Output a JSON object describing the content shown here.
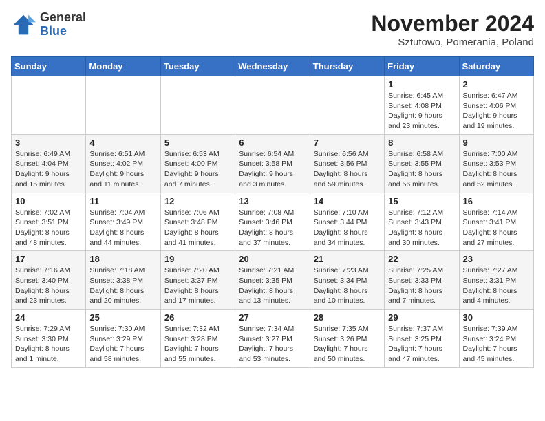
{
  "logo": {
    "general": "General",
    "blue": "Blue"
  },
  "title": "November 2024",
  "subtitle": "Sztutowo, Pomerania, Poland",
  "weekdays": [
    "Sunday",
    "Monday",
    "Tuesday",
    "Wednesday",
    "Thursday",
    "Friday",
    "Saturday"
  ],
  "weeks": [
    [
      {
        "day": "",
        "info": ""
      },
      {
        "day": "",
        "info": ""
      },
      {
        "day": "",
        "info": ""
      },
      {
        "day": "",
        "info": ""
      },
      {
        "day": "",
        "info": ""
      },
      {
        "day": "1",
        "info": "Sunrise: 6:45 AM\nSunset: 4:08 PM\nDaylight: 9 hours\nand 23 minutes."
      },
      {
        "day": "2",
        "info": "Sunrise: 6:47 AM\nSunset: 4:06 PM\nDaylight: 9 hours\nand 19 minutes."
      }
    ],
    [
      {
        "day": "3",
        "info": "Sunrise: 6:49 AM\nSunset: 4:04 PM\nDaylight: 9 hours\nand 15 minutes."
      },
      {
        "day": "4",
        "info": "Sunrise: 6:51 AM\nSunset: 4:02 PM\nDaylight: 9 hours\nand 11 minutes."
      },
      {
        "day": "5",
        "info": "Sunrise: 6:53 AM\nSunset: 4:00 PM\nDaylight: 9 hours\nand 7 minutes."
      },
      {
        "day": "6",
        "info": "Sunrise: 6:54 AM\nSunset: 3:58 PM\nDaylight: 9 hours\nand 3 minutes."
      },
      {
        "day": "7",
        "info": "Sunrise: 6:56 AM\nSunset: 3:56 PM\nDaylight: 8 hours\nand 59 minutes."
      },
      {
        "day": "8",
        "info": "Sunrise: 6:58 AM\nSunset: 3:55 PM\nDaylight: 8 hours\nand 56 minutes."
      },
      {
        "day": "9",
        "info": "Sunrise: 7:00 AM\nSunset: 3:53 PM\nDaylight: 8 hours\nand 52 minutes."
      }
    ],
    [
      {
        "day": "10",
        "info": "Sunrise: 7:02 AM\nSunset: 3:51 PM\nDaylight: 8 hours\nand 48 minutes."
      },
      {
        "day": "11",
        "info": "Sunrise: 7:04 AM\nSunset: 3:49 PM\nDaylight: 8 hours\nand 44 minutes."
      },
      {
        "day": "12",
        "info": "Sunrise: 7:06 AM\nSunset: 3:48 PM\nDaylight: 8 hours\nand 41 minutes."
      },
      {
        "day": "13",
        "info": "Sunrise: 7:08 AM\nSunset: 3:46 PM\nDaylight: 8 hours\nand 37 minutes."
      },
      {
        "day": "14",
        "info": "Sunrise: 7:10 AM\nSunset: 3:44 PM\nDaylight: 8 hours\nand 34 minutes."
      },
      {
        "day": "15",
        "info": "Sunrise: 7:12 AM\nSunset: 3:43 PM\nDaylight: 8 hours\nand 30 minutes."
      },
      {
        "day": "16",
        "info": "Sunrise: 7:14 AM\nSunset: 3:41 PM\nDaylight: 8 hours\nand 27 minutes."
      }
    ],
    [
      {
        "day": "17",
        "info": "Sunrise: 7:16 AM\nSunset: 3:40 PM\nDaylight: 8 hours\nand 23 minutes."
      },
      {
        "day": "18",
        "info": "Sunrise: 7:18 AM\nSunset: 3:38 PM\nDaylight: 8 hours\nand 20 minutes."
      },
      {
        "day": "19",
        "info": "Sunrise: 7:20 AM\nSunset: 3:37 PM\nDaylight: 8 hours\nand 17 minutes."
      },
      {
        "day": "20",
        "info": "Sunrise: 7:21 AM\nSunset: 3:35 PM\nDaylight: 8 hours\nand 13 minutes."
      },
      {
        "day": "21",
        "info": "Sunrise: 7:23 AM\nSunset: 3:34 PM\nDaylight: 8 hours\nand 10 minutes."
      },
      {
        "day": "22",
        "info": "Sunrise: 7:25 AM\nSunset: 3:33 PM\nDaylight: 8 hours\nand 7 minutes."
      },
      {
        "day": "23",
        "info": "Sunrise: 7:27 AM\nSunset: 3:31 PM\nDaylight: 8 hours\nand 4 minutes."
      }
    ],
    [
      {
        "day": "24",
        "info": "Sunrise: 7:29 AM\nSunset: 3:30 PM\nDaylight: 8 hours\nand 1 minute."
      },
      {
        "day": "25",
        "info": "Sunrise: 7:30 AM\nSunset: 3:29 PM\nDaylight: 7 hours\nand 58 minutes."
      },
      {
        "day": "26",
        "info": "Sunrise: 7:32 AM\nSunset: 3:28 PM\nDaylight: 7 hours\nand 55 minutes."
      },
      {
        "day": "27",
        "info": "Sunrise: 7:34 AM\nSunset: 3:27 PM\nDaylight: 7 hours\nand 53 minutes."
      },
      {
        "day": "28",
        "info": "Sunrise: 7:35 AM\nSunset: 3:26 PM\nDaylight: 7 hours\nand 50 minutes."
      },
      {
        "day": "29",
        "info": "Sunrise: 7:37 AM\nSunset: 3:25 PM\nDaylight: 7 hours\nand 47 minutes."
      },
      {
        "day": "30",
        "info": "Sunrise: 7:39 AM\nSunset: 3:24 PM\nDaylight: 7 hours\nand 45 minutes."
      }
    ]
  ]
}
